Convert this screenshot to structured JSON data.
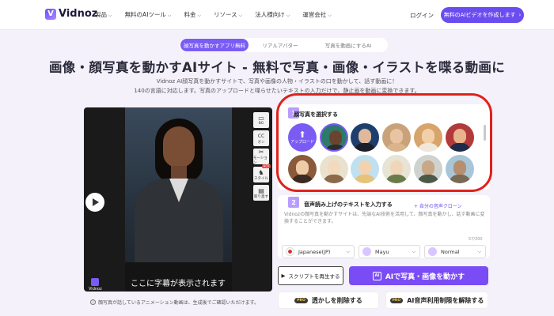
{
  "nav": {
    "brand": "Vidnoz",
    "items": [
      "製品",
      "無料のAIツール",
      "料金",
      "リソース",
      "法人様向け",
      "運営会社"
    ],
    "login": "ログイン",
    "cta": "無料のAIビデオを作成します"
  },
  "tabs": [
    "顔写真を動かすアプリ無料",
    "リアルアバター",
    "写真を動画にするAI"
  ],
  "hero": {
    "title": "画像・顔写真を動かすAIサイト - 無料で写真・画像・イラストを喋る動画に",
    "subtitle1": "Vidnoz AI顔写真を動かすサイトで、写真や画像の人物・イラストの口を動かして、話す動画に！",
    "subtitle2": "140の言語に対応します。写真のアップロードと喋らせたいテキストの入力だけで、静止画を動画に変換できます。"
  },
  "video": {
    "caption": "ここに字幕が表示されます",
    "logo_text": "Vidnoz",
    "tools": [
      {
        "label": "BG",
        "glyph": "▭"
      },
      {
        "label": "オン",
        "glyph": "CC"
      },
      {
        "label": "モーション",
        "glyph": "✂"
      },
      {
        "label": "スタイル",
        "glyph": "♞",
        "badge": "HOT"
      },
      {
        "label": "取り直す",
        "glyph": "▤"
      }
    ],
    "note": "顔写真が話しているアニメーション動画は、生成後でご確認いただけます。"
  },
  "step1": {
    "num": "1",
    "title": "顔写真を選択する",
    "upload_label": "アップロード"
  },
  "step2": {
    "num": "2",
    "title": "音声読み上げのテキストを入力する",
    "link": "+ 自分の音声クローン",
    "text": "Vidnozの顔写真を動かすサイトは、先端なAI技術を活用して、顔写真を動かし、話す動画に変換することができます。",
    "count": "57/300",
    "language": "Japanese(JP)",
    "voice": "Mayu",
    "speed": "Normal"
  },
  "buttons": {
    "script": "スクリプトを再生する",
    "main": "AIで写真・画像を動かす",
    "remove_wm": "透かしを削除する",
    "unlimit": "AI音声利用制限を解除する",
    "pro": "PRO"
  }
}
